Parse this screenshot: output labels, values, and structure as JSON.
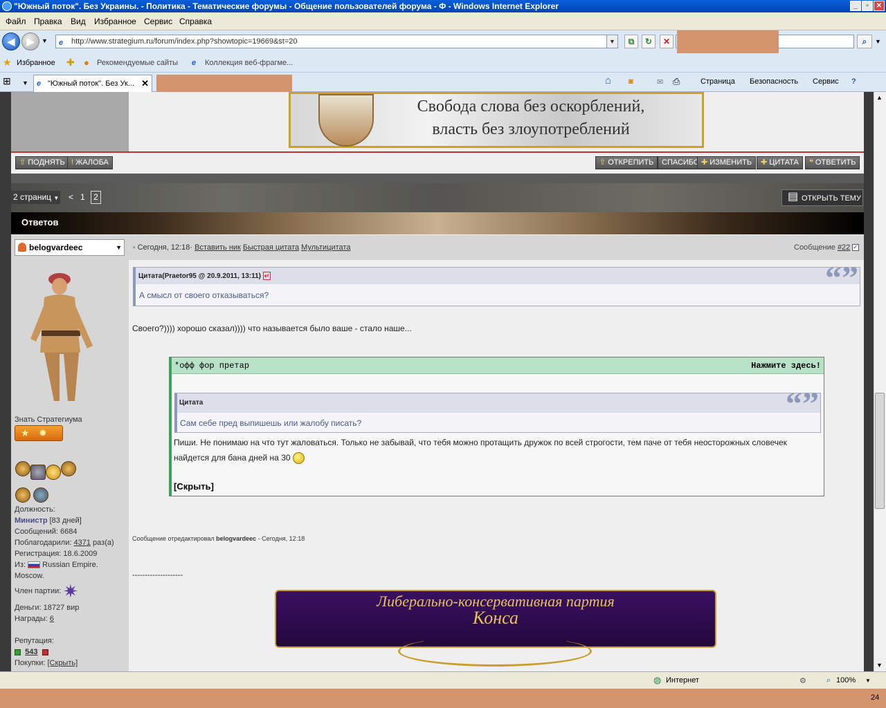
{
  "window": {
    "title": "\"Южный поток\". Без Украины. - Политика - Тематические форумы - Общение пользователей форума - Ф - Windows Internet Explorer",
    "min": "_",
    "max": "▫",
    "close": "✕"
  },
  "menu": [
    "Файл",
    "Правка",
    "Вид",
    "Избранное",
    "Сервис",
    "Справка"
  ],
  "address": {
    "url": "http://www.strategium.ru/forum/index.php?showtopic=19669&st=20"
  },
  "favorites": {
    "label": "Избранное",
    "item1": "Рекомендуемые сайты",
    "item2": "Коллекция веб-фрагме..."
  },
  "tab": {
    "label": "\"Южный поток\". Без Ук..."
  },
  "commandbar": {
    "page": "Страница",
    "security": "Безопасность",
    "service": "Сервис"
  },
  "banner": {
    "line1": "Свобода слова без оскорблений,",
    "line2": "власть без злоупотреблений"
  },
  "buttons": {
    "raise": "ПОДНЯТЬ",
    "complaint": "ЖАЛОБА",
    "unpin": "ОТКРЕПИТЬ",
    "thanks": "СПАСИБО",
    "edit": "ИЗМЕНИТЬ",
    "quote": "ЦИТАТА",
    "reply": "ОТВЕТИТЬ"
  },
  "pagination": {
    "pages": "2 страниц",
    "prev": "<",
    "p1": "1",
    "p2": "2"
  },
  "open_topic": "ОТКРЫТЬ ТЕМУ",
  "answers": "Ответов",
  "post": {
    "username": "belogvardeec",
    "time": "Сегодня, 12:18",
    "insert_nick": "Вставить ник",
    "quick_quote": "Быстрая цитата",
    "multiquote": "Мультицитата",
    "message_label": "Сообщение",
    "message_num": "#22",
    "quote1_header": "Цитата(Praetor95 @ 20.9.2011, 13:11)",
    "quote1_text": "А смысл от своего отказываться?",
    "body": "Своего?)))) хорошо сказал)))) что называется было ваше - стало наше...",
    "spoiler_header": "*офф фор претар",
    "spoiler_toggle": "Нажмите здесь!",
    "quote2_header": "Цитата",
    "quote2_text": "Сам себе пред выпишешь или жалобу писать?",
    "spoiler_text": "Пиши. Не понимаю на что тут жаловаться. Только не забывай, что тебя можно протащить дружок по всей строгости, тем паче от тебя неосторожных словечек найдется для бана дней на 30",
    "hide": "[Скрыть]",
    "edited_prefix": "Сообщение отредактировал",
    "edited_user": "belogvardeec",
    "edited_time": "- Сегодня, 12:18",
    "sig_line": "--------------------",
    "sig_banner_line1": "Либерально-консервативная партия",
    "sig_banner_line2": "Конса"
  },
  "sidebar": {
    "rank_title": "Знать Стратегиума",
    "position_label": "Должность:",
    "position_value": "Министр",
    "position_days": "[83 дней]",
    "messages": "Сообщений: 6684",
    "thanked_prefix": "Поблагодарили:",
    "thanked_count": "4371",
    "thanked_suffix": "раз(а)",
    "registration": "Регистрация: 18.6.2009",
    "from_label": "Из:",
    "from_value": "Russian Empire.",
    "from_city": "Moscow.",
    "party": "Член партии:",
    "money": "Деньги: 18727 вир",
    "awards_prefix": "Награды:",
    "awards_count": "6",
    "reputation_label": "Репутация:",
    "reputation_value": "543",
    "purchases_label": "Покупки:",
    "purchases_value": "[Скрыть]"
  },
  "status": {
    "zone": "Интернет",
    "zoom": "100%"
  },
  "clock": "24"
}
